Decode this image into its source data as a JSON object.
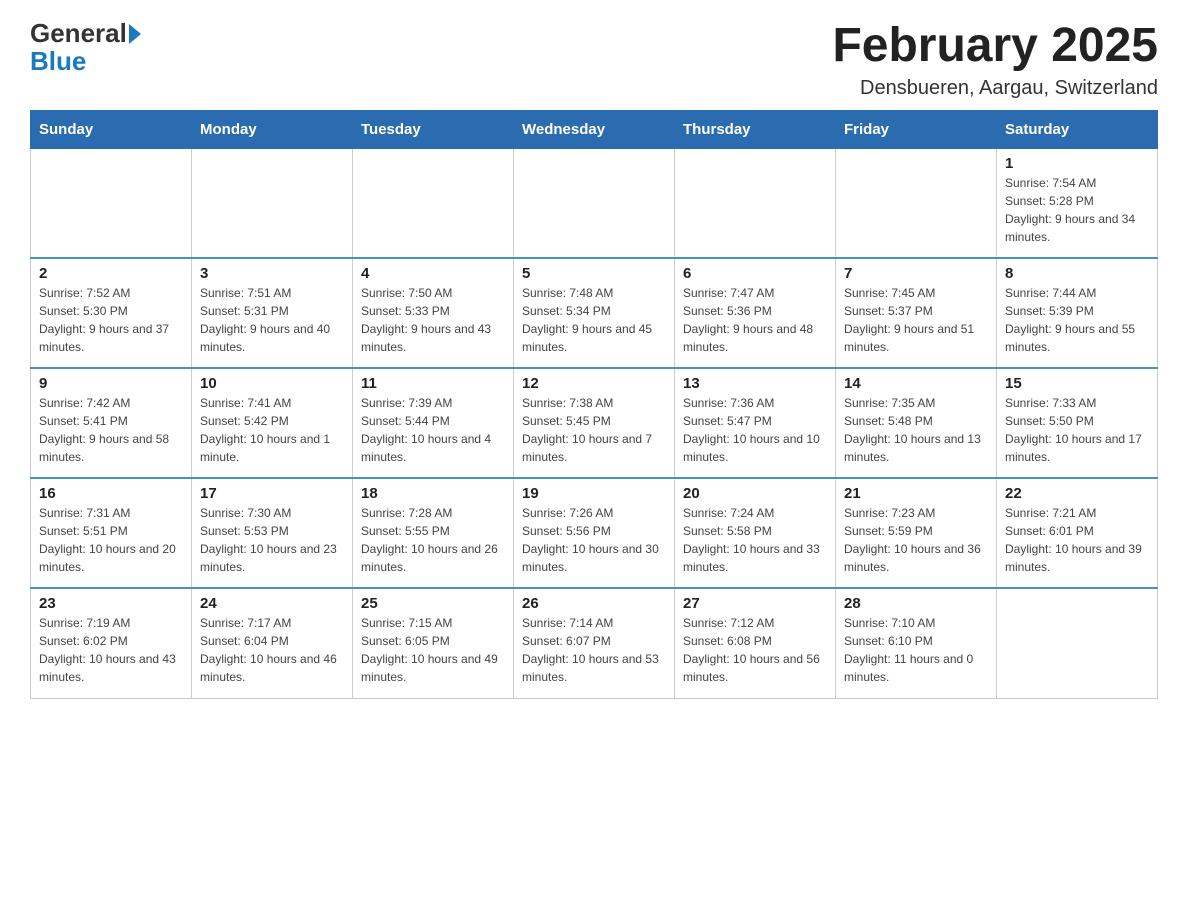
{
  "header": {
    "logo_general": "General",
    "logo_blue": "Blue",
    "title": "February 2025",
    "location": "Densbueren, Aargau, Switzerland"
  },
  "days_of_week": [
    "Sunday",
    "Monday",
    "Tuesday",
    "Wednesday",
    "Thursday",
    "Friday",
    "Saturday"
  ],
  "weeks": [
    [
      {
        "day": "",
        "info": ""
      },
      {
        "day": "",
        "info": ""
      },
      {
        "day": "",
        "info": ""
      },
      {
        "day": "",
        "info": ""
      },
      {
        "day": "",
        "info": ""
      },
      {
        "day": "",
        "info": ""
      },
      {
        "day": "1",
        "info": "Sunrise: 7:54 AM\nSunset: 5:28 PM\nDaylight: 9 hours and 34 minutes."
      }
    ],
    [
      {
        "day": "2",
        "info": "Sunrise: 7:52 AM\nSunset: 5:30 PM\nDaylight: 9 hours and 37 minutes."
      },
      {
        "day": "3",
        "info": "Sunrise: 7:51 AM\nSunset: 5:31 PM\nDaylight: 9 hours and 40 minutes."
      },
      {
        "day": "4",
        "info": "Sunrise: 7:50 AM\nSunset: 5:33 PM\nDaylight: 9 hours and 43 minutes."
      },
      {
        "day": "5",
        "info": "Sunrise: 7:48 AM\nSunset: 5:34 PM\nDaylight: 9 hours and 45 minutes."
      },
      {
        "day": "6",
        "info": "Sunrise: 7:47 AM\nSunset: 5:36 PM\nDaylight: 9 hours and 48 minutes."
      },
      {
        "day": "7",
        "info": "Sunrise: 7:45 AM\nSunset: 5:37 PM\nDaylight: 9 hours and 51 minutes."
      },
      {
        "day": "8",
        "info": "Sunrise: 7:44 AM\nSunset: 5:39 PM\nDaylight: 9 hours and 55 minutes."
      }
    ],
    [
      {
        "day": "9",
        "info": "Sunrise: 7:42 AM\nSunset: 5:41 PM\nDaylight: 9 hours and 58 minutes."
      },
      {
        "day": "10",
        "info": "Sunrise: 7:41 AM\nSunset: 5:42 PM\nDaylight: 10 hours and 1 minute."
      },
      {
        "day": "11",
        "info": "Sunrise: 7:39 AM\nSunset: 5:44 PM\nDaylight: 10 hours and 4 minutes."
      },
      {
        "day": "12",
        "info": "Sunrise: 7:38 AM\nSunset: 5:45 PM\nDaylight: 10 hours and 7 minutes."
      },
      {
        "day": "13",
        "info": "Sunrise: 7:36 AM\nSunset: 5:47 PM\nDaylight: 10 hours and 10 minutes."
      },
      {
        "day": "14",
        "info": "Sunrise: 7:35 AM\nSunset: 5:48 PM\nDaylight: 10 hours and 13 minutes."
      },
      {
        "day": "15",
        "info": "Sunrise: 7:33 AM\nSunset: 5:50 PM\nDaylight: 10 hours and 17 minutes."
      }
    ],
    [
      {
        "day": "16",
        "info": "Sunrise: 7:31 AM\nSunset: 5:51 PM\nDaylight: 10 hours and 20 minutes."
      },
      {
        "day": "17",
        "info": "Sunrise: 7:30 AM\nSunset: 5:53 PM\nDaylight: 10 hours and 23 minutes."
      },
      {
        "day": "18",
        "info": "Sunrise: 7:28 AM\nSunset: 5:55 PM\nDaylight: 10 hours and 26 minutes."
      },
      {
        "day": "19",
        "info": "Sunrise: 7:26 AM\nSunset: 5:56 PM\nDaylight: 10 hours and 30 minutes."
      },
      {
        "day": "20",
        "info": "Sunrise: 7:24 AM\nSunset: 5:58 PM\nDaylight: 10 hours and 33 minutes."
      },
      {
        "day": "21",
        "info": "Sunrise: 7:23 AM\nSunset: 5:59 PM\nDaylight: 10 hours and 36 minutes."
      },
      {
        "day": "22",
        "info": "Sunrise: 7:21 AM\nSunset: 6:01 PM\nDaylight: 10 hours and 39 minutes."
      }
    ],
    [
      {
        "day": "23",
        "info": "Sunrise: 7:19 AM\nSunset: 6:02 PM\nDaylight: 10 hours and 43 minutes."
      },
      {
        "day": "24",
        "info": "Sunrise: 7:17 AM\nSunset: 6:04 PM\nDaylight: 10 hours and 46 minutes."
      },
      {
        "day": "25",
        "info": "Sunrise: 7:15 AM\nSunset: 6:05 PM\nDaylight: 10 hours and 49 minutes."
      },
      {
        "day": "26",
        "info": "Sunrise: 7:14 AM\nSunset: 6:07 PM\nDaylight: 10 hours and 53 minutes."
      },
      {
        "day": "27",
        "info": "Sunrise: 7:12 AM\nSunset: 6:08 PM\nDaylight: 10 hours and 56 minutes."
      },
      {
        "day": "28",
        "info": "Sunrise: 7:10 AM\nSunset: 6:10 PM\nDaylight: 11 hours and 0 minutes."
      },
      {
        "day": "",
        "info": ""
      }
    ]
  ]
}
